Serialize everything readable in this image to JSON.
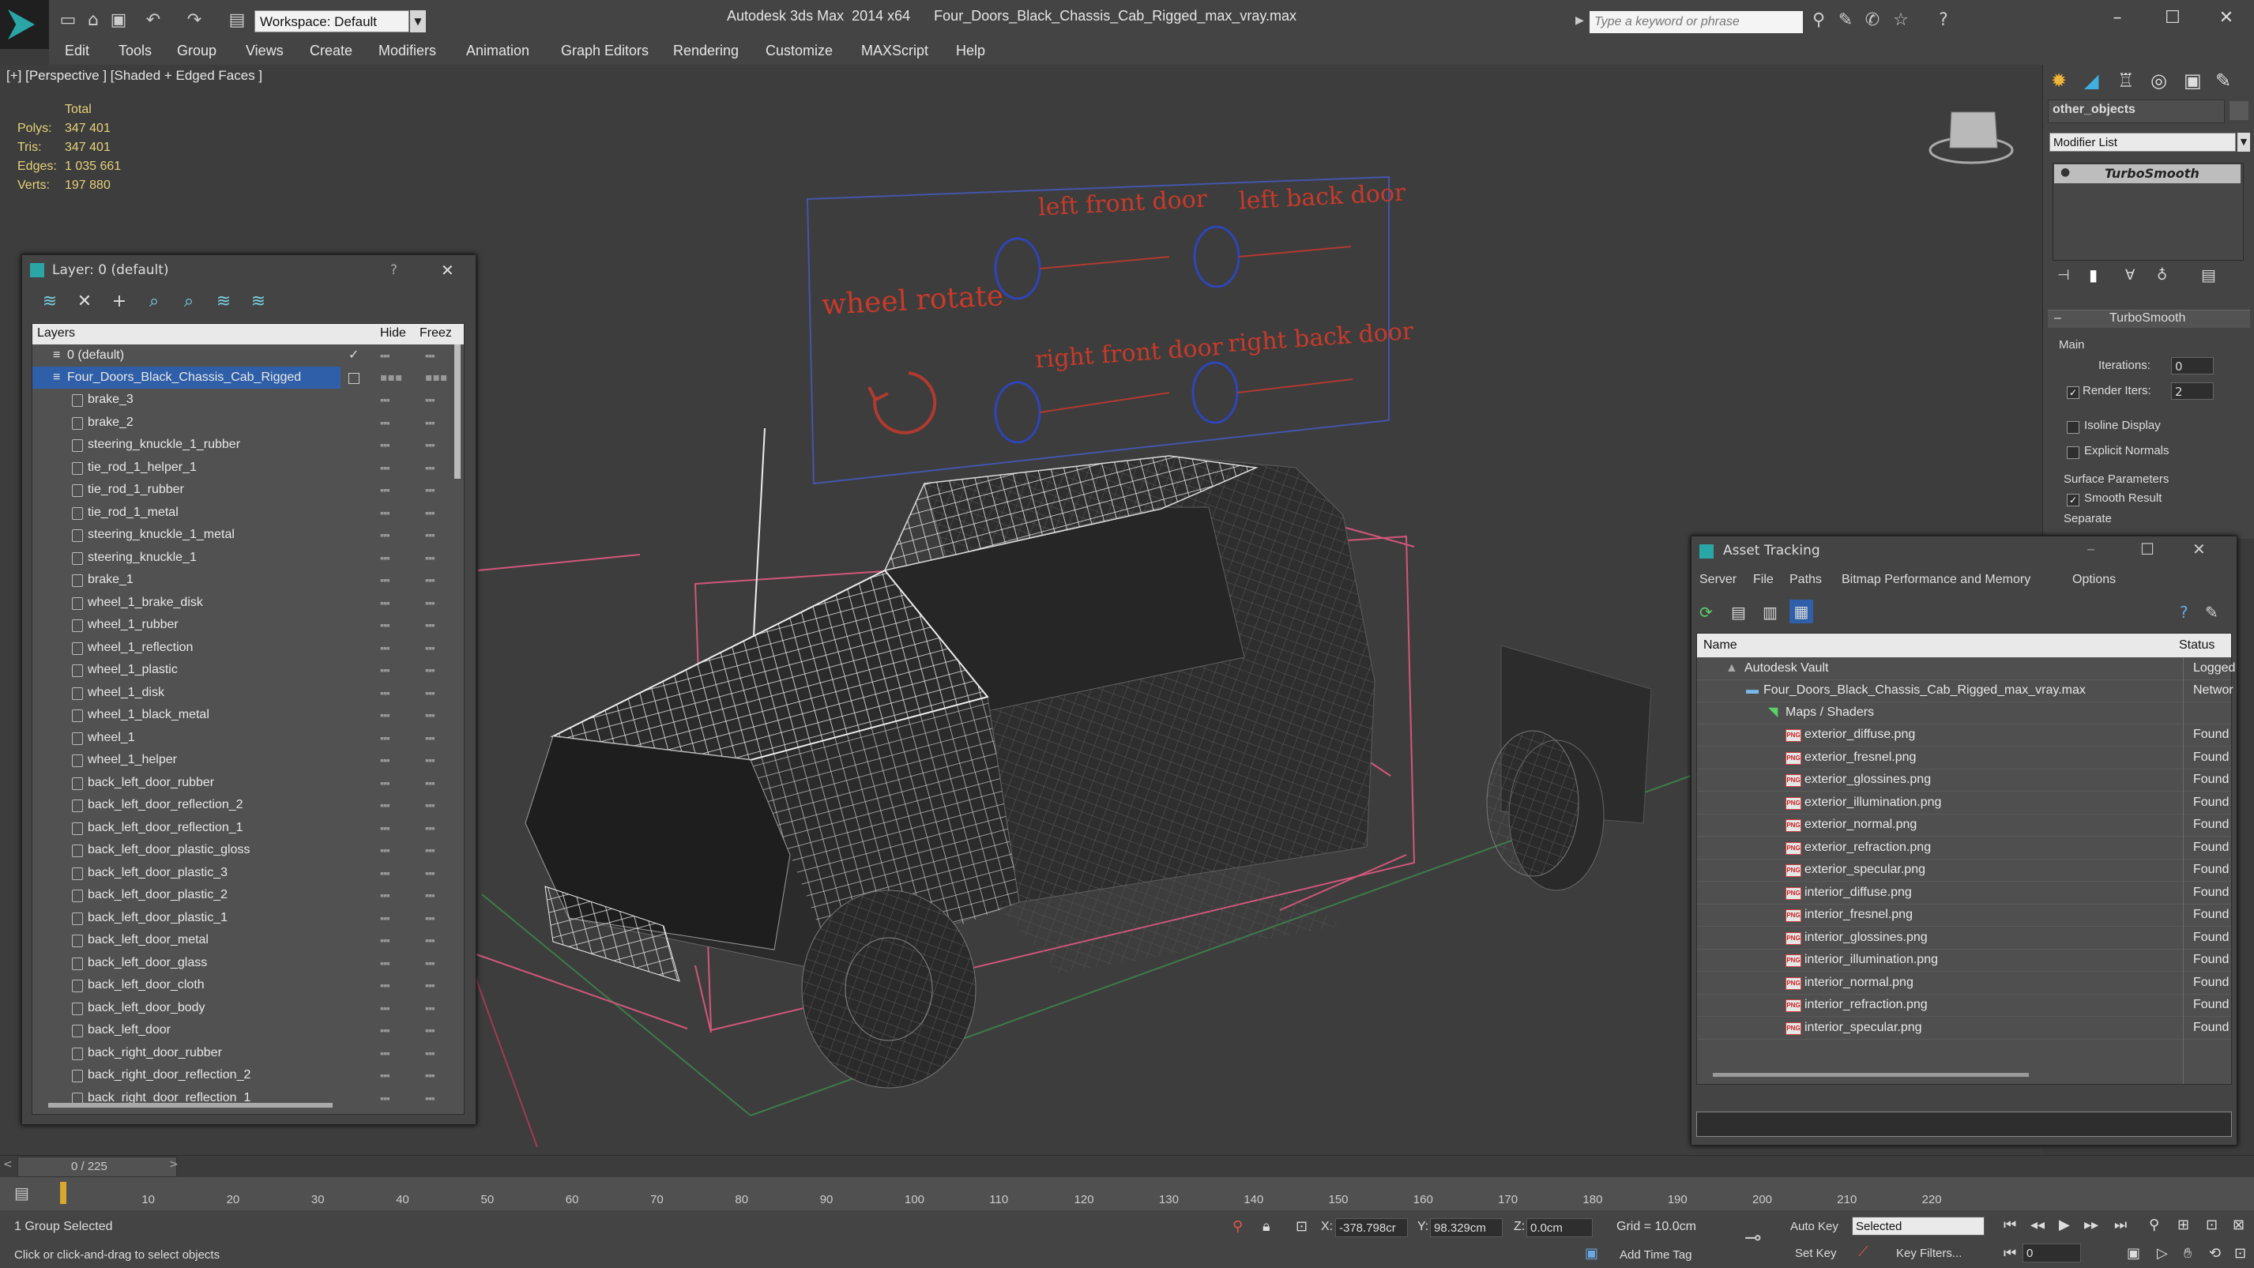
{
  "titlebar": {
    "workspace": "Workspace: Default",
    "app_title": "Autodesk 3ds Max  2014 x64",
    "file_title": "Four_Doors_Black_Chassis_Cab_Rigged_max_vray.max",
    "search_placeholder": "Type a keyword or phrase"
  },
  "menu": [
    "Edit",
    "Tools",
    "Group",
    "Views",
    "Create",
    "Modifiers",
    "Animation",
    "Graph Editors",
    "Rendering",
    "Customize",
    "MAXScript",
    "Help"
  ],
  "viewport": {
    "label": "[+] [Perspective ] [Shaded + Edged Faces ]",
    "stats_header": "Total",
    "stats": [
      {
        "label": "Polys:",
        "value": "347 401"
      },
      {
        "label": "Tris:",
        "value": "347 401"
      },
      {
        "label": "Edges:",
        "value": "1 035 661"
      },
      {
        "label": "Verts:",
        "value": "197 880"
      }
    ],
    "rig_labels": {
      "wheel_rotate": "wheel rotate",
      "left_front_door": "left front door",
      "left_back_door": "left back door",
      "right_front_door": "right front door",
      "right_back_door": "right back door"
    }
  },
  "layer_dialog": {
    "title": "Layer: 0 (default)",
    "help": "?",
    "col_layers": "Layers",
    "col_hide": "Hide",
    "col_freeze": "Freez",
    "default_layer": "0 (default)",
    "selected_layer": "Four_Doors_Black_Chassis_Cab_Rigged",
    "items": [
      "brake_3",
      "brake_2",
      "steering_knuckle_1_rubber",
      "tie_rod_1_helper_1",
      "tie_rod_1_rubber",
      "tie_rod_1_metal",
      "steering_knuckle_1_metal",
      "steering_knuckle_1",
      "brake_1",
      "wheel_1_brake_disk",
      "wheel_1_rubber",
      "wheel_1_reflection",
      "wheel_1_plastic",
      "wheel_1_disk",
      "wheel_1_black_metal",
      "wheel_1",
      "wheel_1_helper",
      "back_left_door_rubber",
      "back_left_door_reflection_2",
      "back_left_door_reflection_1",
      "back_left_door_plastic_gloss",
      "back_left_door_plastic_3",
      "back_left_door_plastic_2",
      "back_left_door_plastic_1",
      "back_left_door_metal",
      "back_left_door_glass",
      "back_left_door_cloth",
      "back_left_door_body",
      "back_left_door",
      "back_right_door_rubber",
      "back_right_door_reflection_2",
      "back_right_door_reflection_1"
    ]
  },
  "command_panel": {
    "object_name": "other_objects",
    "modifier_list": "Modifier List",
    "modifier": "TurboSmooth",
    "rollout": "TurboSmooth",
    "main": "Main",
    "iterations_label": "Iterations:",
    "iterations": "0",
    "render_iters_label": "Render Iters:",
    "render_iters": "2",
    "isoline": "Isoline Display",
    "explicit_normals": "Explicit Normals",
    "surface_params": "Surface Parameters",
    "smooth_result": "Smooth Result",
    "separate": "Separate"
  },
  "asset_tracking": {
    "title": "Asset Tracking",
    "menu": [
      "Server",
      "File",
      "Paths",
      "Bitmap Performance and Memory",
      "Options"
    ],
    "col_name": "Name",
    "col_status": "Status",
    "vault": "Autodesk Vault",
    "vault_status": "Logged",
    "file": "Four_Doors_Black_Chassis_Cab_Rigged_max_vray.max",
    "file_status": "Networ",
    "maps": "Maps / Shaders",
    "png_badge": "PNG",
    "assets": [
      {
        "name": "exterior_diffuse.png",
        "status": "Found"
      },
      {
        "name": "exterior_fresnel.png",
        "status": "Found"
      },
      {
        "name": "exterior_glossines.png",
        "status": "Found"
      },
      {
        "name": "exterior_illumination.png",
        "status": "Found"
      },
      {
        "name": "exterior_normal.png",
        "status": "Found"
      },
      {
        "name": "exterior_refraction.png",
        "status": "Found"
      },
      {
        "name": "exterior_specular.png",
        "status": "Found"
      },
      {
        "name": "interior_diffuse.png",
        "status": "Found"
      },
      {
        "name": "interior_fresnel.png",
        "status": "Found"
      },
      {
        "name": "interior_glossines.png",
        "status": "Found"
      },
      {
        "name": "interior_illumination.png",
        "status": "Found"
      },
      {
        "name": "interior_normal.png",
        "status": "Found"
      },
      {
        "name": "interior_refraction.png",
        "status": "Found"
      },
      {
        "name": "interior_specular.png",
        "status": "Found"
      }
    ]
  },
  "timeline": {
    "frame": "0 / 225",
    "ticks": [
      "10",
      "20",
      "30",
      "40",
      "50",
      "60",
      "70",
      "80",
      "90",
      "100",
      "110",
      "120",
      "130",
      "140",
      "150",
      "160",
      "170",
      "180",
      "190",
      "200",
      "210",
      "220"
    ]
  },
  "status": {
    "selection": "1 Group Selected",
    "prompt": "Click or click-and-drag to select objects",
    "x_label": "X:",
    "x": "-378.798cr",
    "y_label": "Y:",
    "y": "98.329cm",
    "z_label": "Z:",
    "z": "0.0cm",
    "grid": "Grid = 10.0cm",
    "add_time_tag": "Add Time Tag",
    "auto_key": "Auto Key",
    "set_key": "Set Key",
    "selected": "Selected",
    "key_filters": "Key Filters...",
    "frame_field": "0"
  },
  "colors": {
    "rig": "#c83a2a",
    "accent": "#2e5fa8",
    "found": "#e6e6e6"
  }
}
